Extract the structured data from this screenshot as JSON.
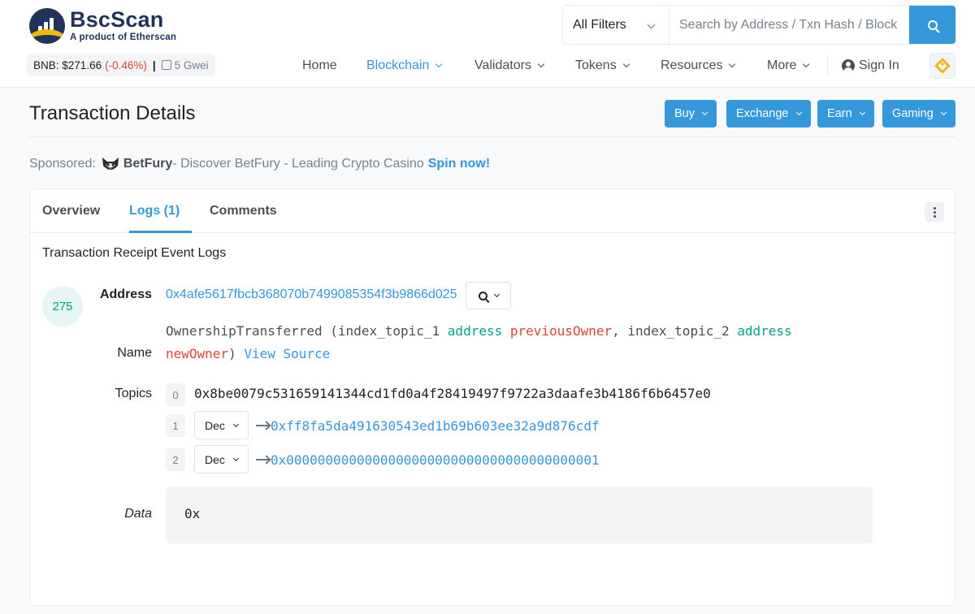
{
  "brand": {
    "name": "BscScan",
    "tagline": "A product of Etherscan"
  },
  "ticker": {
    "label": "BNB:",
    "price": "$271.66",
    "change": "(-0.46%)",
    "separator": "|",
    "gas": "5 Gwei"
  },
  "search": {
    "filter": "All Filters",
    "placeholder": "Search by Address / Txn Hash / Block"
  },
  "nav": {
    "home": "Home",
    "blockchain": "Blockchain",
    "validators": "Validators",
    "tokens": "Tokens",
    "resources": "Resources",
    "more": "More",
    "sign_in": "Sign In"
  },
  "page": {
    "title": "Transaction Details"
  },
  "actions": {
    "buy": "Buy",
    "exchange": "Exchange",
    "earn": "Earn",
    "gaming": "Gaming"
  },
  "sponsored": {
    "label": "Sponsored:",
    "name": "BetFury",
    "text": " - Discover BetFury - Leading Crypto Casino",
    "cta": "Spin now!"
  },
  "tabs": {
    "overview": "Overview",
    "logs": "Logs (1)",
    "comments": "Comments"
  },
  "logs": {
    "section_title": "Transaction Receipt Event Logs",
    "index": "275",
    "address_label": "Address",
    "address": "0x4afe5617fbcb368070b7499085354f3b9866d025",
    "name_label": "Name",
    "event": {
      "name": "OwnershipTransferred",
      "open": " (",
      "p1_topic": "index_topic_1",
      "p1_type": "address",
      "p1_name": "previousOwner",
      "sep": ", ",
      "p2_topic": "index_topic_2",
      "p2_type": "address",
      "p2_name": "newOwner",
      "close": ")",
      "view_source": "View Source"
    },
    "topics_label": "Topics",
    "topics": [
      {
        "index": "0",
        "value": "0x8be0079c531659141344cd1fd0a4f28419497f9722a3daafe3b4186f6b6457e0"
      },
      {
        "index": "1",
        "format": "Dec",
        "value": "0xff8fa5da491630543ed1b69b603ee32a9d876cdf"
      },
      {
        "index": "2",
        "format": "Dec",
        "value": "0x0000000000000000000000000000000000000001"
      }
    ],
    "data_label": "Data",
    "data_value": "0x"
  },
  "colors": {
    "accent": "#3498db",
    "negative": "#de4437",
    "keyword": "#00a186",
    "brand_navy": "#21325b",
    "brand_gold": "#f0b90b"
  },
  "icons": {
    "search": "search-icon",
    "gas": "gas-pump-icon",
    "user": "user-circle-icon",
    "bnb": "bnb-logo-icon",
    "zoom": "zoom-icon",
    "kebab": "more-vertical-icon",
    "arrow": "arrow-right-icon"
  }
}
